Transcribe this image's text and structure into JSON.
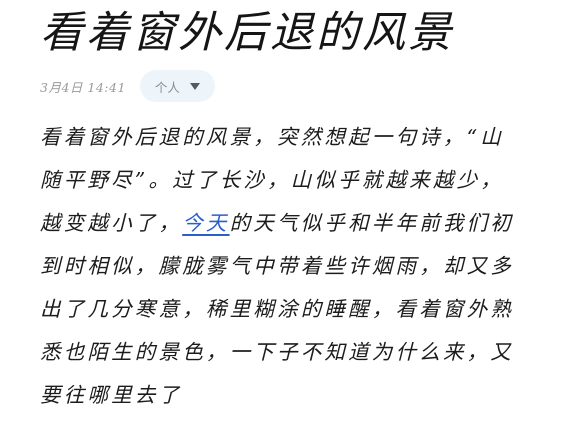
{
  "article": {
    "title": "看着窗外后退的风景",
    "date": "3月4日 14:41",
    "tag": {
      "label": "个人"
    },
    "body": {
      "line1": "看着窗外后退的风景，突然想起一句诗，“山",
      "line2": "随平野尽”。过了长沙，山似乎就越来越少，",
      "line3_before": "越变越小了，",
      "line3_link": "今天",
      "line3_after": "的天气似乎和半年前我们初",
      "line4": "到时相似，朦胧雾气中带着些许烟雨，却又多",
      "line5": "出了几分寒意，稀里糊涂的睡醒，看着窗外熟",
      "line6": "悉也陌生的景色，一下子不知道为什么来，又",
      "line7": "要往哪里去了"
    }
  },
  "colors": {
    "link": "#2b5fcf",
    "tag_background": "#eef5fa",
    "meta_text": "#9a9a9a"
  },
  "icons": {
    "tag_dropdown": "caret-down-icon"
  }
}
